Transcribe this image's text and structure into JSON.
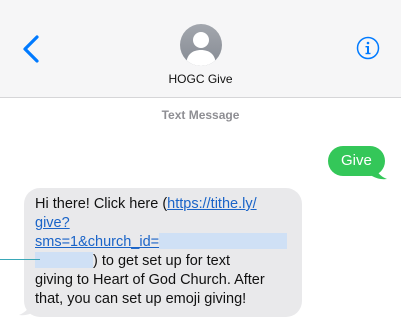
{
  "header": {
    "contact_name": "HOGC Give",
    "back_icon": "chevron-left-icon",
    "info_icon": "info-icon",
    "accent_color": "#007aff"
  },
  "thread": {
    "label": "Text Message"
  },
  "messages": {
    "sent": {
      "text": "Give",
      "color": "#34c759"
    },
    "received": {
      "line1_prefix": "Hi there! Click here (",
      "link_part1": "https://tithe.ly/",
      "link_part2": "give?",
      "link_part3": "sms=1&church_id=",
      "text_after_link": ") to get set up for text",
      "line_giving": "giving to Heart of God Church. After",
      "line_final": "that, you can set up emoji giving!"
    }
  }
}
